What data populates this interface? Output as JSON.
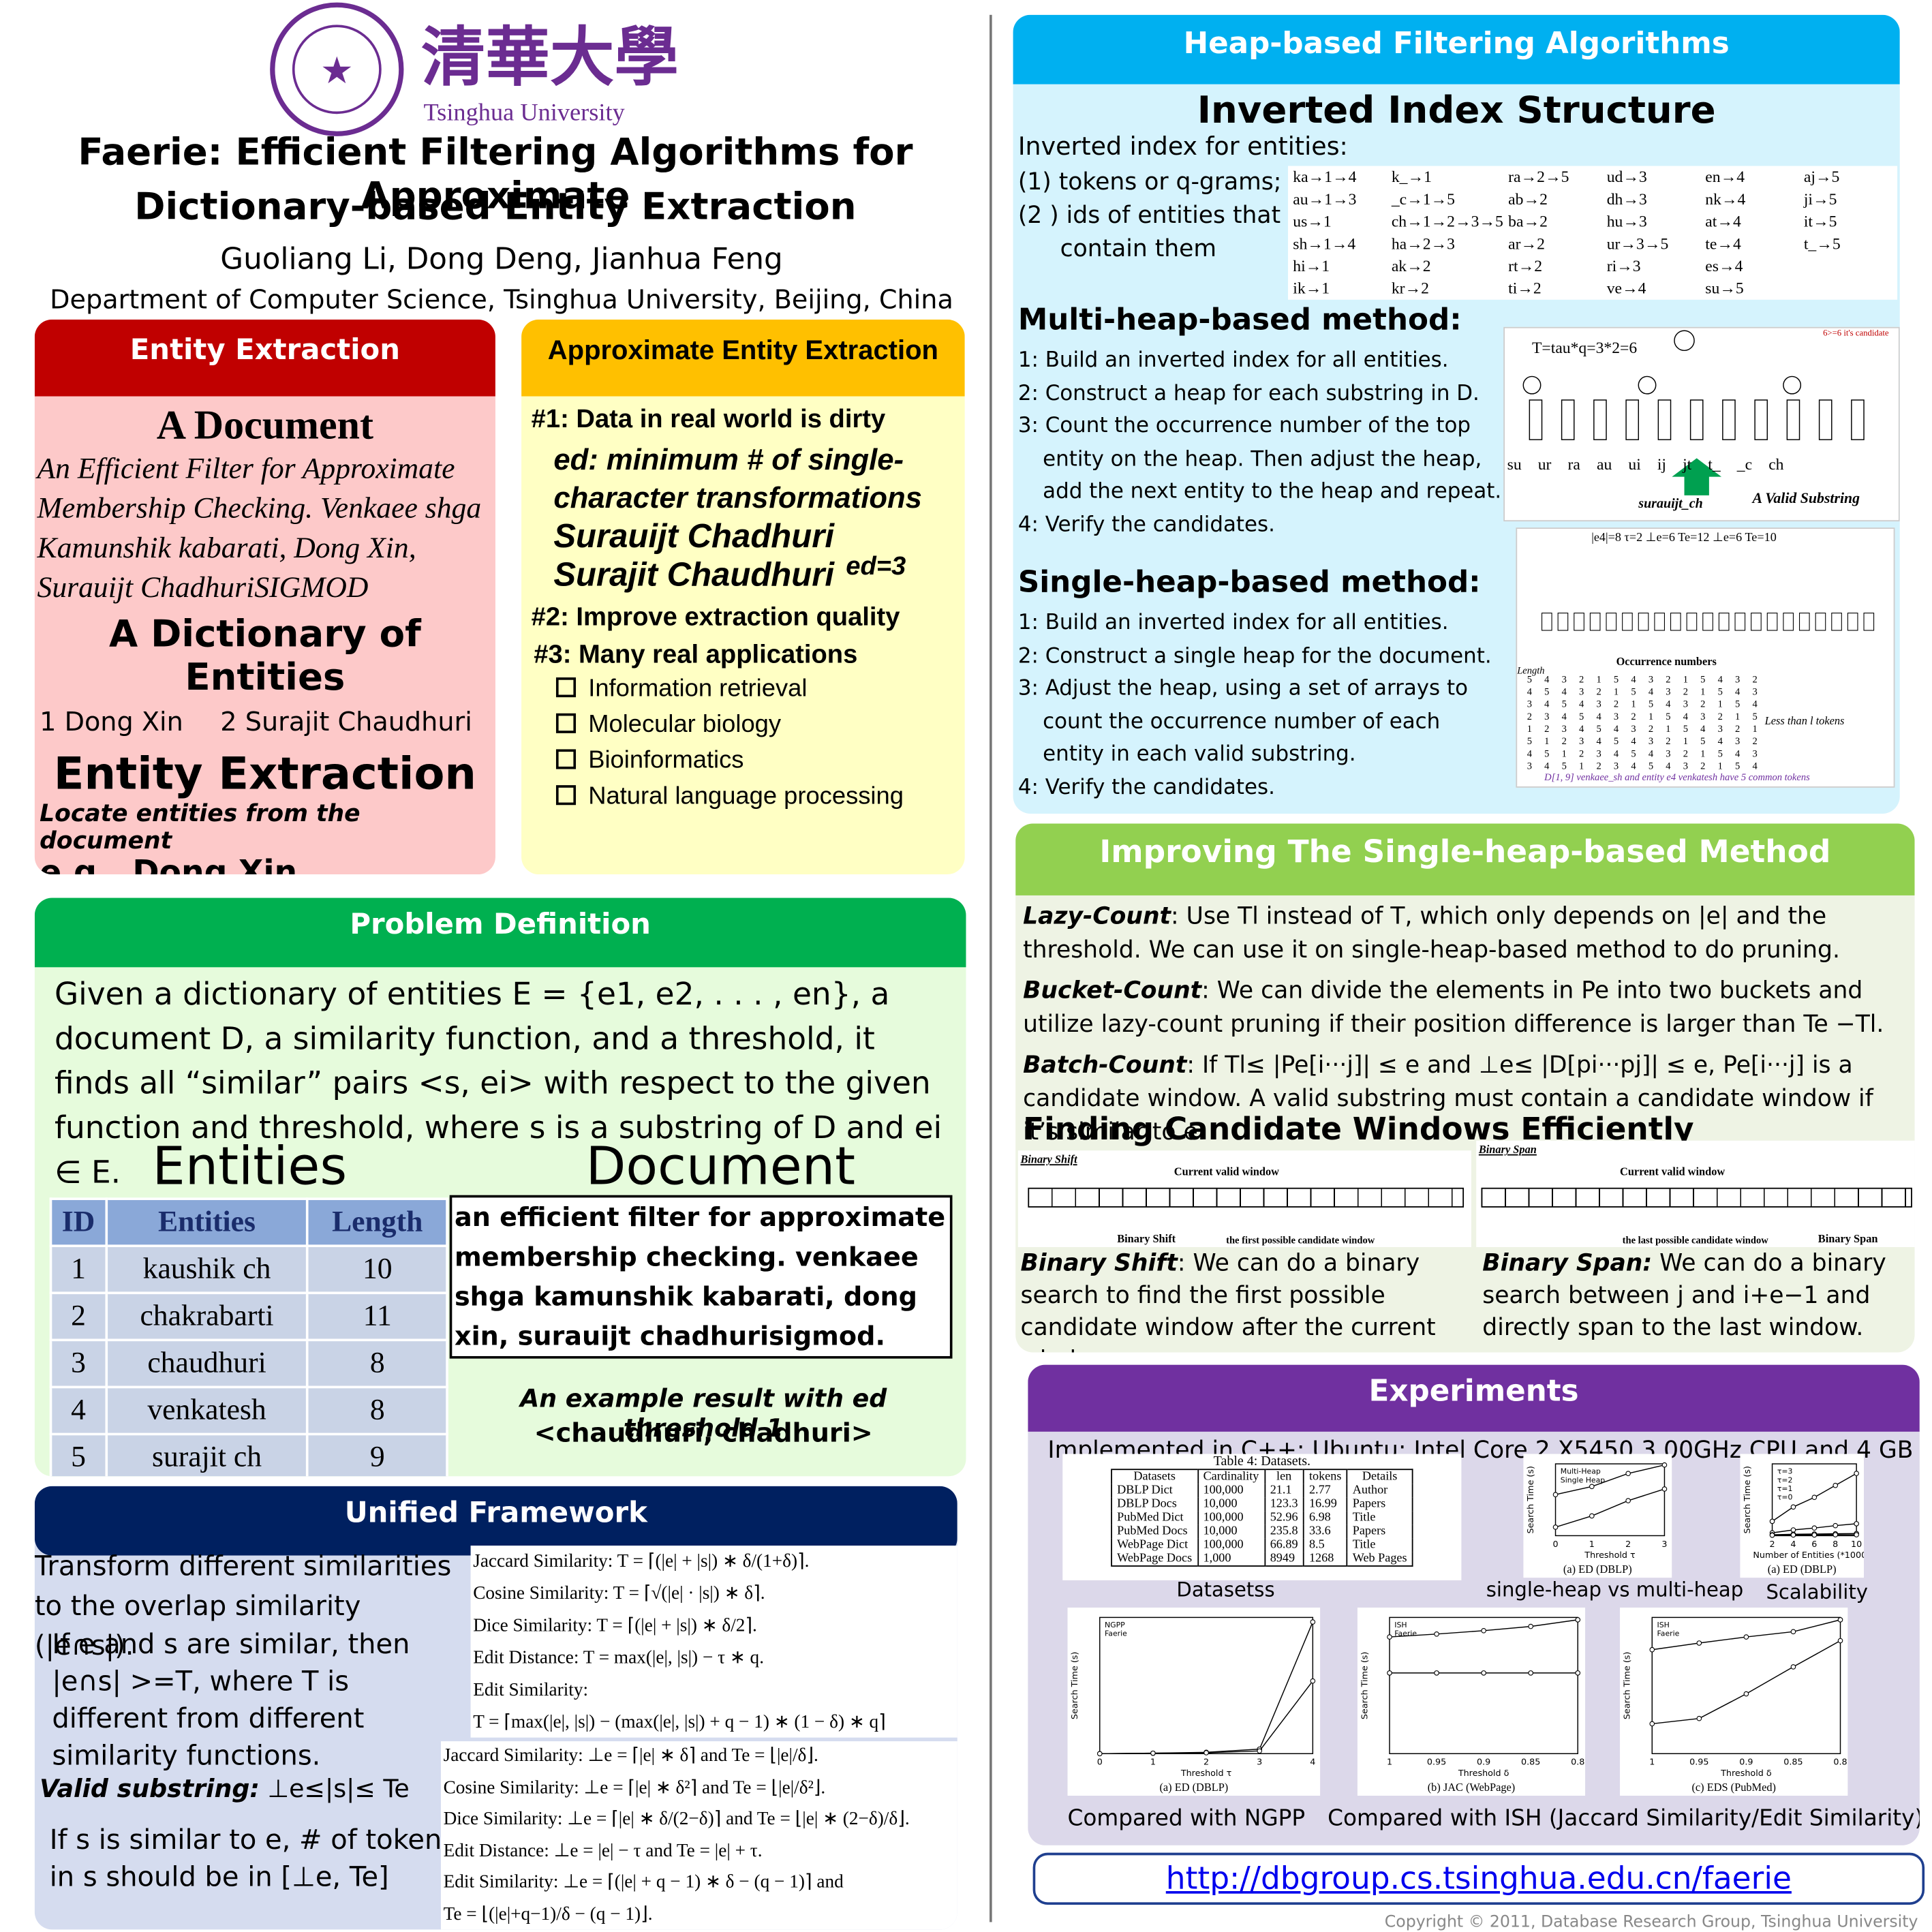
{
  "header": {
    "university_logo_text": "清華大學",
    "university_name": "Tsinghua University",
    "title_line1": "Faerie: Efficient Filtering Algorithms for Approximate",
    "title_line2": "Dictionary-based Entity Extraction",
    "authors": "Guoliang Li, Dong Deng, Jianhua Feng",
    "affiliation": "Department of Computer Science, Tsinghua University, Beijing, China"
  },
  "entity_extraction": {
    "header": "Entity Extraction",
    "doc_title": "A Document",
    "doc_text": "An Efficient Filter for Approximate Membership Checking. Venkaee shga Kamunshik kabarati, Dong Xin, Surauijt ChadhuriSIGMOD",
    "dict_title": "A Dictionary of Entities",
    "dict_items": [
      "1 Dong Xin",
      "2 Surajit Chaudhuri"
    ],
    "ee_title": "Entity Extraction",
    "ee_sub": "Locate entities from the document",
    "ee_example": "e.g., Dong Xin"
  },
  "approx": {
    "header": "Approximate Entity Extraction",
    "p1": "#1: Data in real world is dirty",
    "ed_def": "ed: minimum # of single-character transformations",
    "name1": "Surauijt Chadhuri",
    "name2": "Surajit Chaudhuri",
    "ed_label": "ed=3",
    "p2": "#2: Improve extraction quality",
    "p3": "#3: Many real applications",
    "apps": [
      "Information retrieval",
      "Molecular biology",
      "Bioinformatics",
      "Natural language processing"
    ]
  },
  "problem": {
    "header": "Problem Definition",
    "text": "Given a dictionary of entities E = {e1, e2, . . . , en}, a document D, a similarity function, and a threshold, it finds all “similar” pairs <s, ei> with respect to the given function and threshold, where s is a substring of D and ei ∈ E.",
    "entities_label": "Entities",
    "document_label": "Document",
    "columns": [
      "ID",
      "Entities",
      "Length"
    ],
    "rows": [
      [
        "1",
        "kaushik ch",
        "10"
      ],
      [
        "2",
        "chakrabarti",
        "11"
      ],
      [
        "3",
        "chaudhuri",
        "8"
      ],
      [
        "4",
        "venkatesh",
        "8"
      ],
      [
        "5",
        "surajit ch",
        "9"
      ]
    ],
    "document_text": "an efficient filter for approximate membership checking. venkaee shga kamunshik kabarati, dong xin, surauijt chadhurisigmod.",
    "example_caption": "An example result with ed threshold 1",
    "example_result": "<chaudhuri, chadhuri>"
  },
  "unified": {
    "header": "Unified Framework",
    "t1": "Transform different similarities to the overlap similarity (|e∩s|).",
    "t2": "If e and s are similar, then |e∩s| >=T, where T is different from different similarity functions.",
    "valid_label": "Valid substring:",
    "valid_formula": "⊥e≤|s|≤ Te",
    "t3": "If s is similar to e, # of tokens in s should be in [⊥e, Te]",
    "formulas_T": [
      "Jaccard Similarity: T = ⌈(|e| + |s|) ∗ δ/(1+δ)⌉.",
      "Cosine Similarity: T = ⌈√(|e| · |s|) ∗ δ⌉.",
      "Dice Similarity: T = ⌈(|e| + |s|) ∗ δ/2⌉.",
      "Edit Distance: T = max(|e|, |s|) − τ ∗ q.",
      "Edit Similarity:",
      "T = ⌈max(|e|, |s|) − (max(|e|, |s|) + q − 1) ∗ (1 − δ) ∗ q⌉"
    ],
    "formulas_bounds": [
      "Jaccard Similarity: ⊥e = ⌈|e| ∗ δ⌉ and Te = ⌊|e|/δ⌋.",
      "Cosine Similarity: ⊥e = ⌈|e| ∗ δ²⌉ and Te = ⌊|e|/δ²⌋.",
      "Dice Similarity: ⊥e = ⌈|e| ∗ δ/(2−δ)⌉ and Te = ⌊|e| ∗ (2−δ)/δ⌋.",
      "Edit Distance: ⊥e = |e| − τ and Te = |e| + τ.",
      "Edit Similarity: ⊥e = ⌈(|e| + q − 1) ∗ δ − (q − 1)⌉ and",
      "Te = ⌊(|e|+q−1)/δ − (q − 1)⌋."
    ]
  },
  "heap": {
    "header": "Heap-based Filtering Algorithms",
    "inv_title": "Inverted Index Structure",
    "inv_intro": "Inverted index for entities:",
    "inv_items": [
      "(1) tokens or q-grams;",
      "(2 ) ids of entities  that",
      "contain them"
    ],
    "inv_cols": [
      [
        "ka→1→4",
        "au→1→3",
        "us→1",
        "sh→1→4",
        "hi→1",
        "ik→1"
      ],
      [
        "k_→1",
        "_c→1→5",
        "ch→1→2→3→5",
        "ha→2→3",
        "ak→2",
        "kr→2"
      ],
      [
        "ra→2→5",
        "ab→2",
        "ba→2",
        "ar→2",
        "rt→2",
        "ti→2"
      ],
      [
        "ud→3",
        "dh→3",
        "hu→3",
        "ur→3→5",
        "ri→3",
        "ve→4"
      ],
      [
        "en→4",
        "nk→4",
        "at→4",
        "te→4",
        "es→4",
        "su→5"
      ],
      [
        "aj→5",
        "ji→5",
        "it→5",
        "t_→5"
      ]
    ],
    "multi_title": "Multi-heap-based method:",
    "multi_steps": [
      "1: Build an inverted index for all entities.",
      "2: Construct a heap for each substring in D.",
      "3: Count the occurrence number of the top",
      "entity on the heap. Then adjust the heap,",
      "add the next entity to the heap and repeat.",
      "4: Verify the candidates."
    ],
    "multi_fig": {
      "formula": "T=tau*q=3*2=6",
      "tokens": [
        "su",
        "ur",
        "ra",
        "au",
        "ui",
        "ij",
        "jt",
        "t_",
        "_c",
        "ch"
      ],
      "arrow_label": "surauijt_ch",
      "valid_label": "A Valid Substring",
      "candidate": "6>=6 it's candidate"
    },
    "single_title": "Single-heap-based method:",
    "single_steps": [
      "1: Build an inverted index for all entities.",
      "2: Construct a single heap for the document.",
      "3: Adjust the heap, using a set of arrays to",
      "count the occurrence number of each",
      "entity in each valid substring.",
      "4: Verify the candidates."
    ],
    "single_fig": {
      "params": "|e4|=8  τ=2  ⊥e=6  Te=12  ⊥e=6  Te=10",
      "occ": "Occurrence numbers",
      "less": "Less than l tokens",
      "length": "Length",
      "note": "D[1, 9] venkaee_sh and entity e4 venkatesh have 5 common tokens"
    }
  },
  "improving": {
    "header": "Improving The Single-heap-based Method",
    "lazy_label": "Lazy-Count",
    "lazy_text": ": Use Tl instead of T, which only depends on |e| and the threshold. We can use it on single-heap-based method to do pruning.",
    "bucket_label": "Bucket-Count",
    "bucket_text": ": We can divide the elements in Pe into two buckets and utilize lazy-count pruning if their position difference is larger than Te −Tl.",
    "batch_label": "Batch-Count",
    "batch_text": ": If Tl≤ |Pe[i···j]| ≤ e and ⊥e≤ |D[pi···pj]| ≤ e, Pe[i···j] is a candidate window. A valid substring must contain a candidate window if it’s similar to e.",
    "finding_title": "Finding Candidate Windows Efficiently",
    "bs_fig": {
      "title": "Binary Shift",
      "cvw": "Current valid window",
      "l1": "Binary Shift",
      "l2": "the first possible candidate window"
    },
    "bsp_fig": {
      "title": "Binary Span",
      "cvw": "Current valid window",
      "l1": "the last possible candidate window",
      "l2": "Binary Span"
    },
    "shift_label": "Binary Shift",
    "shift_text": ": We can do a binary search to find the first possible candidate window after the current window",
    "span_label": "Binary Span:",
    "span_text": " We can do a binary search between j and i+e−1 and directly span to the last window."
  },
  "experiments": {
    "header": "Experiments",
    "impl": "Implemented in C++;  Ubuntu: Intel Core 2 X5450 3.00GHz CPU and 4 GB RAM.",
    "table_title": "Table 4: Datasets.",
    "table_cols": [
      "Datasets",
      "Cardinality",
      "len",
      "tokens",
      "Details"
    ],
    "table_rows": [
      [
        "DBLP Dict",
        "100,000",
        "21.1",
        "2.77",
        "Author"
      ],
      [
        "DBLP Docs",
        "10,000",
        "123.3",
        "16.99",
        "Papers"
      ],
      [
        "PubMed Dict",
        "100,000",
        "52.96",
        "6.98",
        "Title"
      ],
      [
        "PubMed Docs",
        "10,000",
        "235.8",
        "33.6",
        "Papers"
      ],
      [
        "WebPage Dict",
        "100,000",
        "66.89",
        "8.5",
        "Title"
      ],
      [
        "WebPage Docs",
        "1,000",
        "8949",
        "1268",
        "Web Pages"
      ]
    ],
    "cap_datasets": "Datasetss",
    "cap_heap": "single-heap vs multi-heap",
    "cap_scal": "Scalability",
    "charts": [
      {
        "type": "line",
        "sub": "(a) ED (DBLP)",
        "xlabel": "Threshold τ",
        "ylabel": "Search Time (s)",
        "x": [
          0,
          1,
          2,
          3
        ],
        "log_y": true,
        "series": [
          {
            "name": "Multi-Heap",
            "values": [
              80,
              300,
              2500,
              10000
            ]
          },
          {
            "name": "Single Heap",
            "values": [
              0.4,
              2.5,
              30,
              200
            ]
          }
        ]
      },
      {
        "type": "line",
        "sub": "(a) ED (DBLP)",
        "xlabel": "Number of Entities (*10000)",
        "ylabel": "Search Time (s)",
        "x": [
          2,
          4,
          6,
          8,
          10
        ],
        "ylim": [
          0,
          30
        ],
        "series": [
          {
            "name": "τ=3",
            "values": [
              6,
              12,
              16,
              21,
              26
            ]
          },
          {
            "name": "τ=2",
            "values": [
              1.2,
              2.4,
              3.2,
              4.2,
              5
            ]
          },
          {
            "name": "τ=1",
            "values": [
              0.4,
              0.6,
              0.7,
              0.8,
              0.9
            ]
          },
          {
            "name": "τ=0",
            "values": [
              0.2,
              0.3,
              0.3,
              0.4,
              0.4
            ]
          }
        ]
      },
      {
        "type": "line",
        "sub": "(a) ED (DBLP)",
        "xlabel": "Threshold τ",
        "ylabel": "Search Time (s)",
        "x": [
          0,
          1,
          2,
          3,
          4
        ],
        "ylim": [
          0,
          300
        ],
        "series": [
          {
            "name": "NGPP",
            "values": [
              0,
              1,
              3,
              10,
              290
            ]
          },
          {
            "name": "Faerie",
            "values": [
              0,
              1,
              2,
              6,
              160
            ]
          }
        ]
      },
      {
        "type": "line",
        "sub": "(b) JAC (WebPage)",
        "xlabel": "Threshold δ",
        "ylabel": "Search Time (s)",
        "x": [
          1,
          0.95,
          0.9,
          0.85,
          0.8
        ],
        "log_y": true,
        "series": [
          {
            "name": "ISH",
            "values": [
              800,
              1000,
              1300,
              1800,
              3000
            ]
          },
          {
            "name": "Faerie",
            "values": [
              50,
              50,
              50,
              50,
              50
            ]
          }
        ]
      },
      {
        "type": "line",
        "sub": "(c) EDS (PubMed)",
        "xlabel": "Threshold δ",
        "ylabel": "Search Time (s)",
        "x": [
          1,
          0.95,
          0.9,
          0.85,
          0.8
        ],
        "log_y": true,
        "series": [
          {
            "name": "ISH",
            "values": [
              300,
              500,
              800,
              1200,
              3000
            ]
          },
          {
            "name": "Faerie",
            "values": [
              1,
              1.5,
              10,
              80,
              600
            ]
          }
        ]
      }
    ],
    "cap_ngpp": "Compared with NGPP",
    "cap_ish": "Compared with ISH (Jaccard Similarity/Edit Similarity)"
  },
  "link": "http://dbgroup.cs.tsinghua.edu.cn/faerie",
  "copyright": "Copyright © 2011, Database Research Group, Tsinghua University",
  "colors": {
    "red": "#c00000",
    "yellow": "#ffc000",
    "green": "#00b050",
    "navy": "#002060",
    "blue": "#00b0f0",
    "lightgreen": "#92d050",
    "purple": "#7030a0"
  }
}
